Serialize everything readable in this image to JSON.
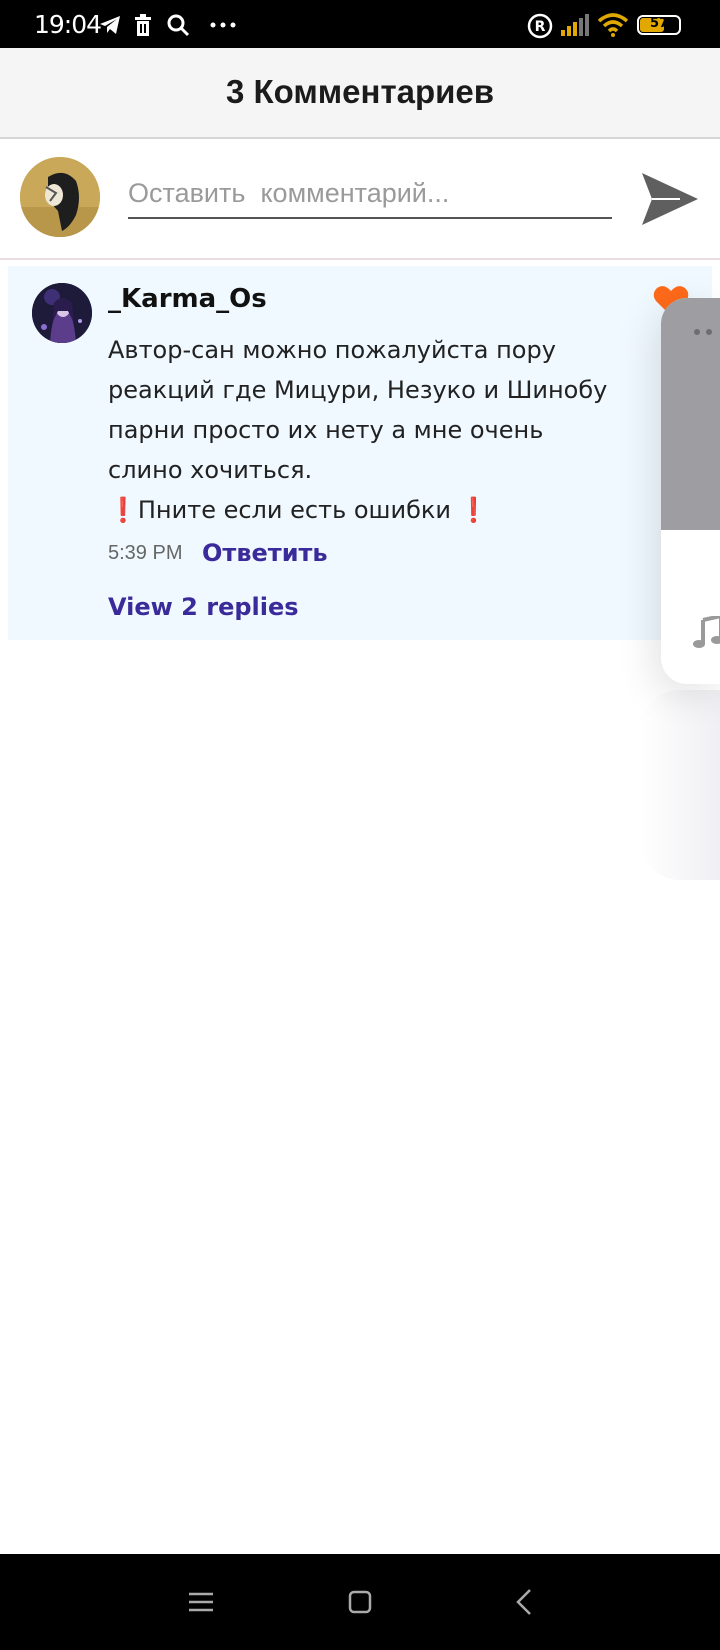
{
  "status_bar": {
    "time": "19:04",
    "battery": "57",
    "icons": [
      "telegram-icon",
      "trash-icon",
      "search-icon",
      "more-icon",
      "registered-icon",
      "signal-icon",
      "wifi-icon",
      "battery-icon"
    ]
  },
  "header": {
    "title": "3 Комментариев"
  },
  "composer": {
    "placeholder": "Оставить  комментарий...",
    "send_icon": "send-icon"
  },
  "comments": [
    {
      "author": "_Karma_Os",
      "text": "Автор-сан можно пожалуйста пору\nреакций где Мицури, Незуко и Шинобу\nпарни просто их нету а мне очень\nслино хочиться.\n❗Пните если есть ошибки ❗",
      "time": "5:39 PM",
      "reply_label": "Ответить",
      "view_replies": "View 2 replies",
      "liked": true
    }
  ],
  "colors": {
    "accent": "#3a2a9a",
    "heart": "#ff6a1a",
    "card_bg": "#f0f9ff",
    "header_bg": "#f5f5f5"
  },
  "nav_bar": {
    "icons": [
      "menu-icon",
      "home-icon",
      "back-icon"
    ]
  }
}
